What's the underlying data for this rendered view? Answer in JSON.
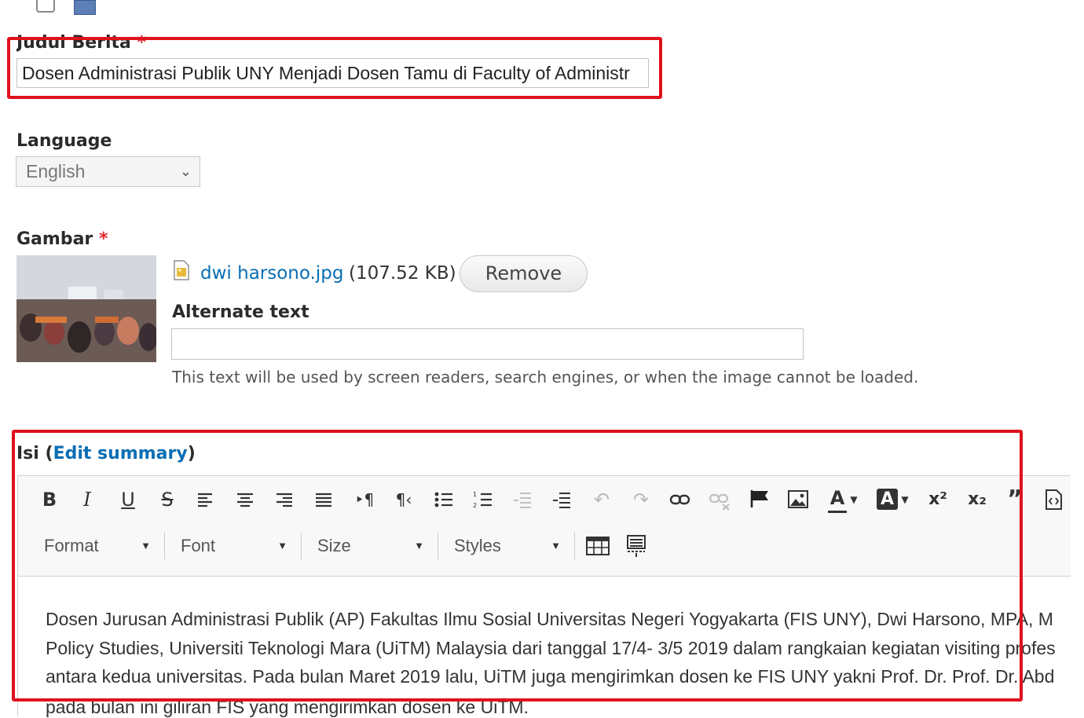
{
  "title_field": {
    "label": "Judul Berita",
    "required_mark": "*",
    "value": "Dosen Administrasi Publik UNY Menjadi Dosen Tamu di Faculty of Administr"
  },
  "language_field": {
    "label": "Language",
    "selected": "English"
  },
  "image_field": {
    "label": "Gambar",
    "required_mark": "*",
    "file_name": "dwi harsono.jpg",
    "file_size": "(107.52 KB)",
    "remove_label": "Remove",
    "alt_label": "Alternate text",
    "alt_value": "",
    "alt_help": "This text will be used by screen readers, search engines, or when the image cannot be loaded."
  },
  "body_field": {
    "label": "Isi",
    "paren_open": "(",
    "edit_summary": "Edit summary",
    "paren_close": ")",
    "toolbar": {
      "bold": "B",
      "italic": "I",
      "underline": "U",
      "strike": "S",
      "superscript": "x²",
      "subscript": "x₂",
      "text_color": "A",
      "bg_color": "A",
      "combos": [
        "Format",
        "Font",
        "Size",
        "Styles"
      ]
    },
    "content_lines": [
      "Dosen Jurusan Administrasi Publik (AP) Fakultas Ilmu Sosial Universitas Negeri Yogyakarta (FIS UNY), Dwi Harsono, MPA, M",
      "Policy Studies, Universiti Teknologi Mara (UiTM) Malaysia dari tanggal 17/4- 3/5 2019 dalam rangkaian kegiatan visiting profes",
      "antara kedua universitas. Pada bulan Maret 2019 lalu, UiTM juga mengirimkan dosen ke FIS UNY yakni Prof. Dr. Prof. Dr. Abd",
      "pada bulan ini giliran FIS yang mengirimkan dosen ke UiTM."
    ]
  },
  "colors": {
    "highlight": "#e0101d",
    "link": "#0a6eb4",
    "required": "#e3262f"
  }
}
